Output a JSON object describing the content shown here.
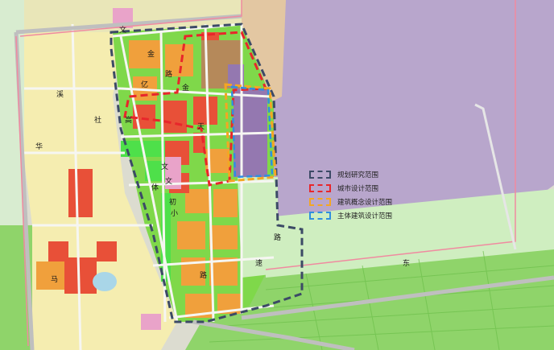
{
  "legend": {
    "items": [
      {
        "label": "规划研究范围",
        "color": "#3c4a66"
      },
      {
        "label": "城市设计范围",
        "color": "#e8262b"
      },
      {
        "label": "建筑概念设计范围",
        "color": "#f4a623"
      },
      {
        "label": "主体建筑设计范围",
        "color": "#2f8fe0"
      }
    ]
  },
  "map_labels": {
    "lu": "路",
    "jin": "金",
    "wen": "文",
    "gao": "高",
    "yi": "亿",
    "chu": "初",
    "xiao": "小",
    "ti": "体",
    "she": "社",
    "hua": "华",
    "dong": "东",
    "su": "速",
    "xi": "溪",
    "ma": "马",
    "tian": "天"
  },
  "colors": {
    "residential_yellow": "#f5edb0",
    "commercial_red": "#e85038",
    "orange": "#f0a03c",
    "green": "#7fd84a",
    "bright_green": "#4ee04a",
    "purple_zone": "#b8a6cc",
    "farmland": "#8fd46a",
    "water": "#a9d6e8",
    "tan": "#b5895a",
    "pink": "#e9a3c9"
  }
}
